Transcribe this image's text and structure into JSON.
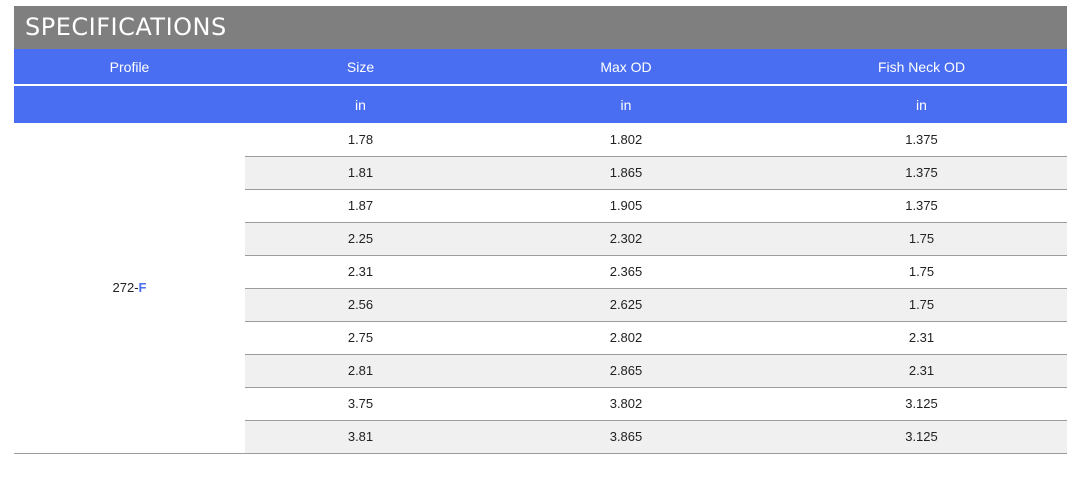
{
  "title": "SPECIFICATIONS",
  "columns": {
    "profile": "Profile",
    "size": "Size",
    "max_od": "Max OD",
    "fish_neck_od": "Fish Neck OD"
  },
  "units": {
    "profile": "",
    "size": "in",
    "max_od": "in",
    "fish_neck_od": "in"
  },
  "profile": {
    "prefix": "272-",
    "suffix": "F"
  },
  "rows": [
    {
      "size": "1.78",
      "max_od": "1.802",
      "fish_neck_od": "1.375"
    },
    {
      "size": "1.81",
      "max_od": "1.865",
      "fish_neck_od": "1.375"
    },
    {
      "size": "1.87",
      "max_od": "1.905",
      "fish_neck_od": "1.375"
    },
    {
      "size": "2.25",
      "max_od": "2.302",
      "fish_neck_od": "1.75"
    },
    {
      "size": "2.31",
      "max_od": "2.365",
      "fish_neck_od": "1.75"
    },
    {
      "size": "2.56",
      "max_od": "2.625",
      "fish_neck_od": "1.75"
    },
    {
      "size": "2.75",
      "max_od": "2.802",
      "fish_neck_od": "2.31"
    },
    {
      "size": "2.81",
      "max_od": "2.865",
      "fish_neck_od": "2.31"
    },
    {
      "size": "3.75",
      "max_od": "3.802",
      "fish_neck_od": "3.125"
    },
    {
      "size": "3.81",
      "max_od": "3.865",
      "fish_neck_od": "3.125"
    }
  ],
  "colors": {
    "title_bar": "#7f7f7f",
    "header_bg": "#4a6ef1",
    "alt_row_bg": "#f0f0f0",
    "profile_suffix": "#4a6ef1"
  }
}
